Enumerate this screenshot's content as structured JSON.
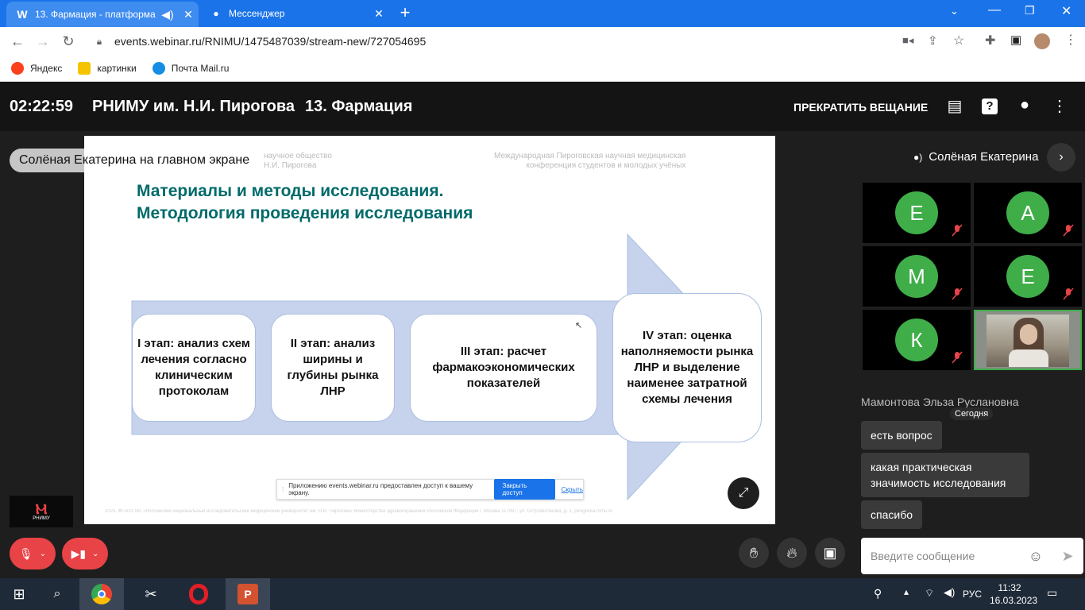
{
  "browser": {
    "tabs": [
      {
        "favicon": "W",
        "title": "13. Фармация - платформа"
      },
      {
        "title": "Мессенджер"
      }
    ],
    "url": "events.webinar.ru/RNIMU/1475487039/stream-new/727054695",
    "bookmarks": [
      {
        "label": "Яндекс",
        "color": "#fc3f1d"
      },
      {
        "label": "картинки",
        "color": "#f5c400"
      },
      {
        "label": "Почта Mail.ru",
        "color": "#168de2"
      }
    ]
  },
  "header": {
    "timer": "02:22:59",
    "org": "РНИМУ им. Н.И. Пирогова",
    "event": "13. Фармация",
    "stop_label": "ПРЕКРАТИТЬ ВЕЩАНИЕ"
  },
  "main": {
    "badge": "Солёная Екатерина на главном экране",
    "slide": {
      "header_left": "научное общество\nН.И. Пирогова",
      "header_right": "Международная Пироговская научная медицинская\nконференция студентов и молодых учёных",
      "title1": "Материалы и методы исследования.",
      "title2": "Методология проведения исследования",
      "stages": [
        "I этап: анализ схем лечения согласно клиническим протоколам",
        "II этап: анализ ширины и глубины рынка ЛНР",
        "III этап: расчет фармакоэкономических показателей",
        "IV этап: оценка наполняемости рынка ЛНР и выделение наименее затратной схемы лечения"
      ],
      "share_notice": "Приложению events.webinar.ru предоставлен доступ к вашему экрану.",
      "share_stop": "Закрыть доступ",
      "share_hide": "Скрыть",
      "footer": "2024. ФГАОУ ВО «Российский национальный исследовательский медицинский университет им. Н.И. Пирогова» Министерства здравоохранения Российской Федерации г. Москва 117997, ул. Островитянова, д. 1, pirogovka.rsmu.ru"
    },
    "logo_text": "РНИМУ"
  },
  "sidebar": {
    "presenter": "Солёная Екатерина",
    "participants": [
      {
        "initial": "Е"
      },
      {
        "initial": "А"
      },
      {
        "initial": "М"
      },
      {
        "initial": "Е"
      },
      {
        "initial": "К"
      }
    ],
    "chat_author": "Мамонтова Эльза Руслановна",
    "chat_date": "Сегодня",
    "messages": [
      "есть вопрос",
      "какая практическая значимость исследования",
      "спасибо"
    ],
    "input_placeholder": "Введите сообщение"
  },
  "taskbar": {
    "language": "РУС",
    "time": "11:32",
    "date": "16.03.2023"
  },
  "colors": {
    "accent": "#1a73e8",
    "avatar": "#3fae49",
    "danger": "#e84346",
    "slide_title": "#006a6a"
  }
}
